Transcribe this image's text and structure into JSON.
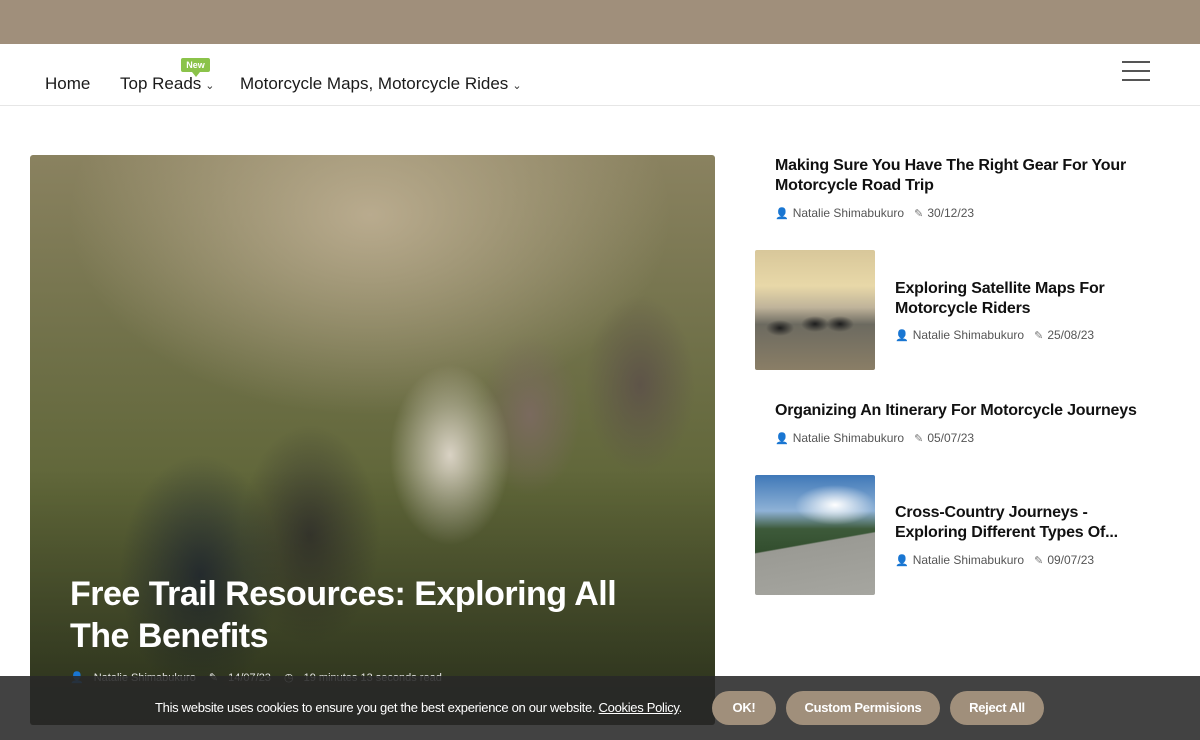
{
  "nav": {
    "items": [
      {
        "label": "Home"
      },
      {
        "label": "Top Reads",
        "badge": "New"
      },
      {
        "label": "Motorcycle Maps, Motorcycle Rides"
      }
    ],
    "caret": "⌄"
  },
  "hero": {
    "title": "Free Trail Resources: Exploring All The Benefits",
    "author": "Natalie Shimabukuro",
    "date": "14/07/23",
    "read_time": "19 minutes 13 seconds read"
  },
  "sidebar": {
    "posts": [
      {
        "title": "Making Sure You Have The Right Gear For Your Motorcycle Road Trip",
        "author": "Natalie Shimabukuro",
        "date": "30/12/23"
      },
      {
        "title": "Exploring Satellite Maps For Motorcycle Riders",
        "author": "Natalie Shimabukuro",
        "date": "25/08/23"
      },
      {
        "title": "Organizing An Itinerary For Motorcycle Journeys",
        "author": "Natalie Shimabukuro",
        "date": "05/07/23"
      },
      {
        "title": "Cross-Country Journeys - Exploring Different Types Of...",
        "author": "Natalie Shimabukuro",
        "date": "09/07/23"
      }
    ]
  },
  "cookie": {
    "text": "This website uses cookies to ensure you get the best experience on our website.",
    "policy_link": "Cookies Policy",
    "ok_label": "OK!",
    "custom_label": "Custom Permisions",
    "reject_label": "Reject All"
  },
  "colors": {
    "topbar": "#a08f7b",
    "badge": "#8bc34a",
    "cookie_button": "#a08f7b"
  },
  "icons": {
    "author": "user-icon",
    "date": "pencil-icon",
    "time": "clock-icon",
    "menu": "hamburger-icon"
  }
}
